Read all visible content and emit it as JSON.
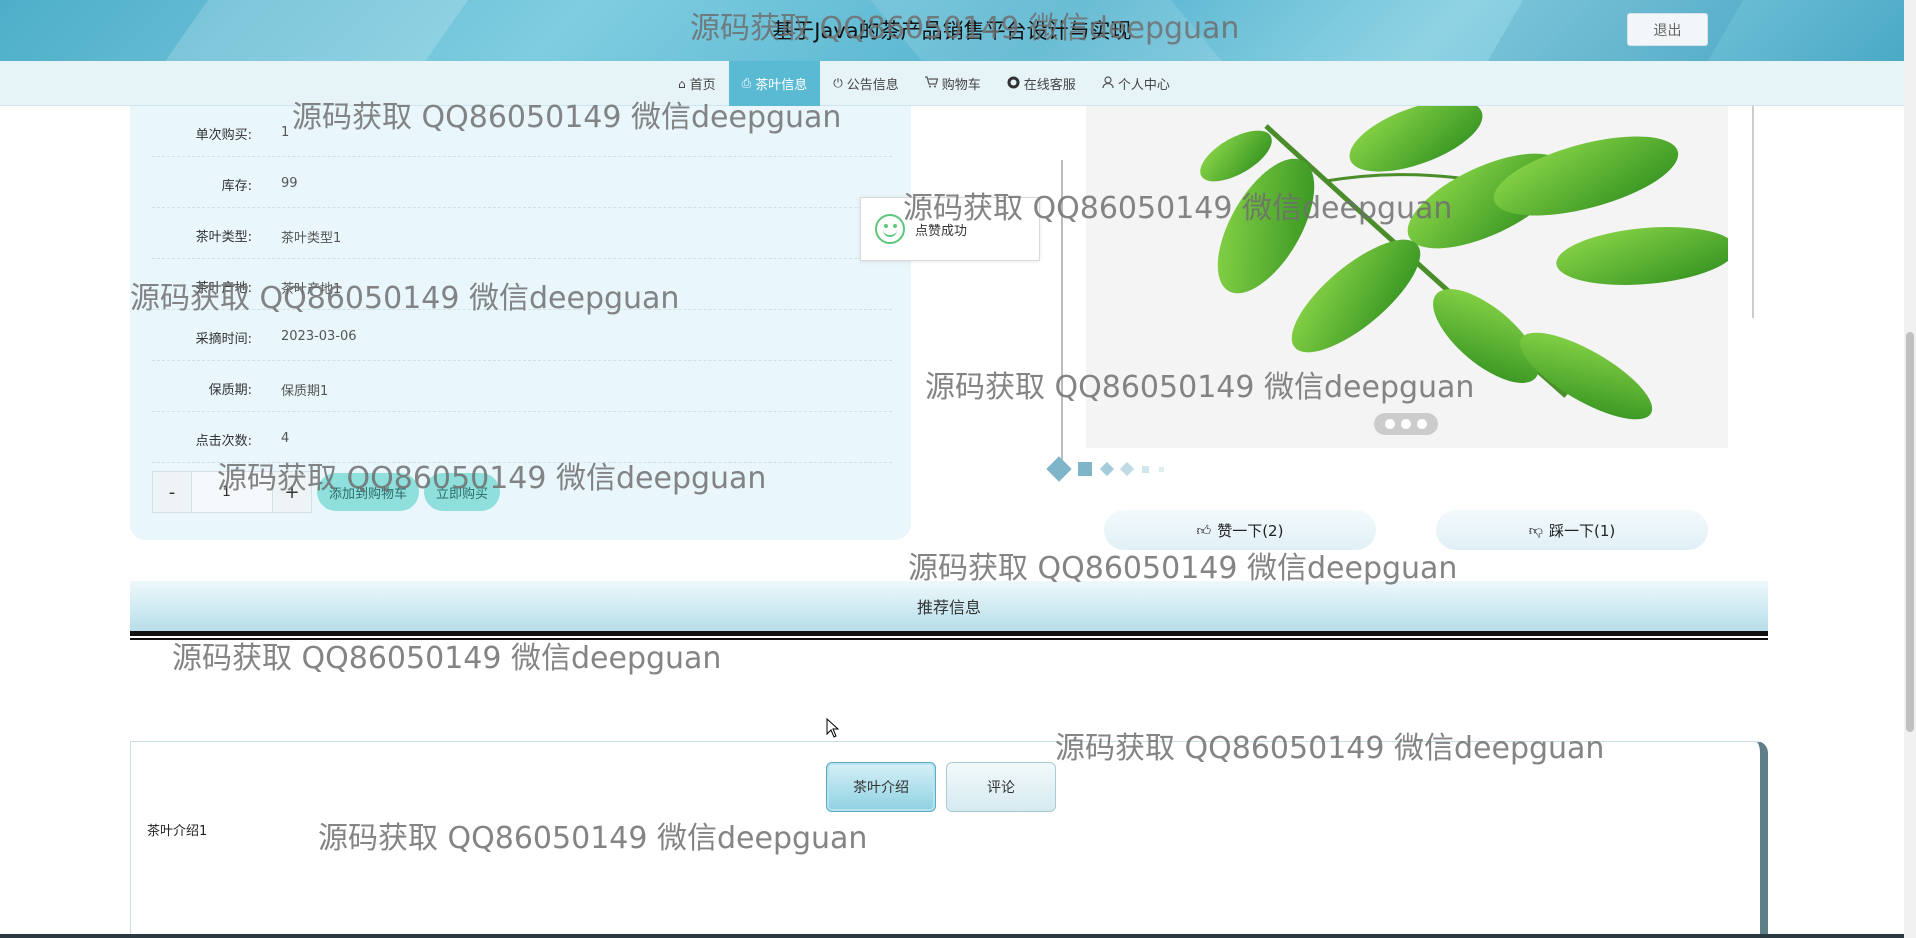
{
  "header": {
    "site_title": "基于Java的茶产品销售平台设计与实现",
    "logout_label": "退出"
  },
  "nav": {
    "items": [
      {
        "label": "首页",
        "icon": "home-icon"
      },
      {
        "label": "茶叶信息",
        "icon": "printer-icon",
        "active": true
      },
      {
        "label": "公告信息",
        "icon": "power-icon"
      },
      {
        "label": "购物车",
        "icon": "cart-icon"
      },
      {
        "label": "在线客服",
        "icon": "chat-icon"
      },
      {
        "label": "个人中心",
        "icon": "user-icon"
      }
    ]
  },
  "detail": {
    "rows": [
      {
        "label": "单次购买:",
        "value": "1"
      },
      {
        "label": "库存:",
        "value": "99"
      },
      {
        "label": "茶叶类型:",
        "value": "茶叶类型1"
      },
      {
        "label": "茶叶产地:",
        "value": "茶叶产地1"
      },
      {
        "label": "采摘时间:",
        "value": "2023-03-06"
      },
      {
        "label": "保质期:",
        "value": "保质期1"
      },
      {
        "label": "点击次数:",
        "value": "4"
      }
    ],
    "quantity": {
      "minus_label": "-",
      "value": "1",
      "plus_label": "+"
    },
    "add_to_cart_label": "添加到购物车",
    "buy_now_label": "立即购买"
  },
  "toast": {
    "message": "点赞成功",
    "icon": "smile-icon"
  },
  "carousel": {
    "image_alt": "tea leaves",
    "dots": 3,
    "active_dot": 1
  },
  "votes": {
    "like_label": "赞一下(2)",
    "dislike_label": "踩一下(1)"
  },
  "recommend": {
    "title": "推荐信息"
  },
  "tabs": {
    "items": [
      {
        "label": "茶叶介绍",
        "active": true
      },
      {
        "label": "评论",
        "active": false
      }
    ],
    "content": "茶叶介绍1"
  },
  "watermark": {
    "text": "源码获取 QQ86050149 微信deepguan"
  },
  "colors": {
    "header_bg": "#5ab9d3",
    "nav_active": "#5ab9d3",
    "panel_bg": "#e9f6fb",
    "pill_bg": "#8fe0dc",
    "toast_icon": "#5cc77c"
  }
}
